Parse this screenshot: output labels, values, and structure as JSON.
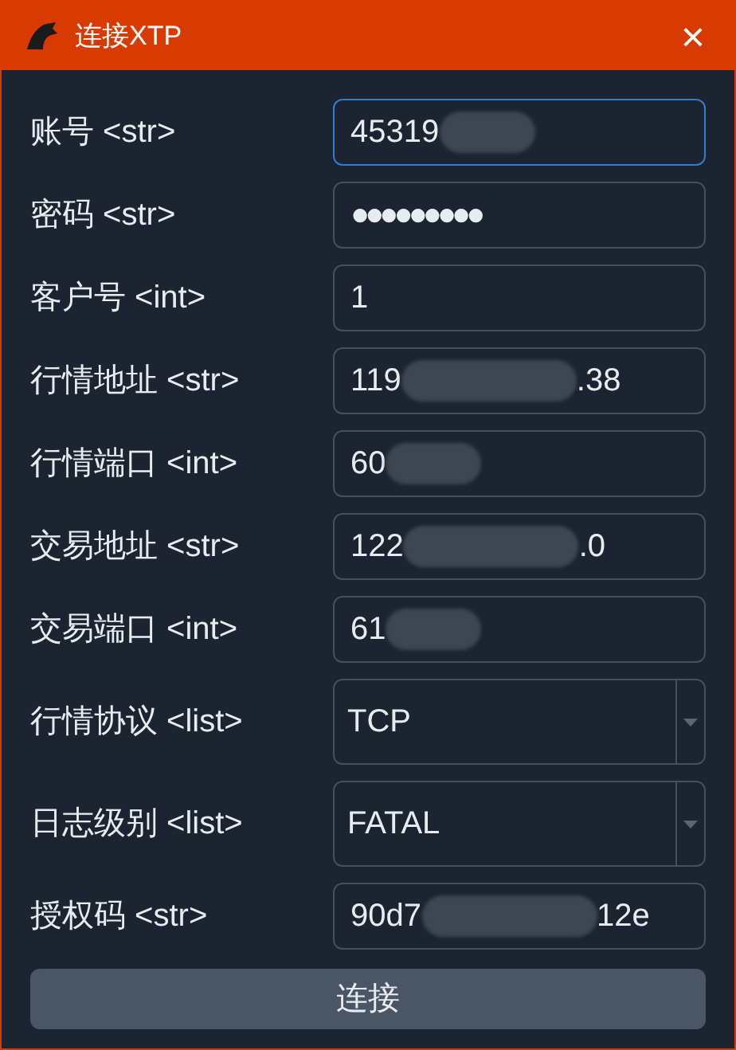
{
  "window": {
    "title": "连接XTP",
    "close": "×"
  },
  "fields": [
    {
      "label": "账号 <str>",
      "kind": "text",
      "value_start": "45319",
      "redacted": true,
      "focused": true
    },
    {
      "label": "密码 <str>",
      "kind": "password",
      "value_start": "●●●●●●●●●",
      "redacted": false,
      "focused": false
    },
    {
      "label": "客户号 <int>",
      "kind": "text",
      "value_start": "1",
      "redacted": false,
      "focused": false
    },
    {
      "label": "行情地址 <str>",
      "kind": "text",
      "value_start": "119",
      "value_end": ".38",
      "redacted": true,
      "focused": false
    },
    {
      "label": "行情端口 <int>",
      "kind": "text",
      "value_start": "60",
      "redacted": true,
      "focused": false
    },
    {
      "label": "交易地址 <str>",
      "kind": "text",
      "value_start": "122",
      "value_end": ".0",
      "redacted": true,
      "focused": false
    },
    {
      "label": "交易端口 <int>",
      "kind": "text",
      "value_start": "61",
      "redacted": true,
      "focused": false
    },
    {
      "label": "行情协议 <list>",
      "kind": "select",
      "value_start": "TCP",
      "redacted": false,
      "focused": false
    },
    {
      "label": "日志级别 <list>",
      "kind": "select",
      "value_start": "FATAL",
      "redacted": false,
      "focused": false
    },
    {
      "label": "授权码 <str>",
      "kind": "text",
      "value_start": "90d7",
      "value_end": "12e",
      "redacted": true,
      "focused": false
    }
  ],
  "button": "连接"
}
